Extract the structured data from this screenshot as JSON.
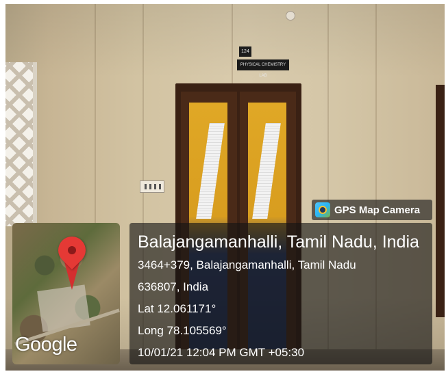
{
  "scene": {
    "room_number": "124",
    "room_name": "PHYSICAL CHEMISTRY LAB"
  },
  "gps_tag": {
    "icon": "gps-map-camera-icon",
    "label": "GPS Map Camera"
  },
  "map": {
    "icon": "location-pin-icon",
    "logo_text": "Google"
  },
  "location": {
    "place": "Balajangamanhalli, Tamil Nadu, India",
    "address_line1": "3464+379, Balajangamanhalli, Tamil Nadu",
    "address_line2": "636807, India",
    "latitude": "Lat 12.061171°",
    "longitude": "Long 78.105569°",
    "timestamp": "10/01/21 12:04 PM GMT +05:30"
  }
}
